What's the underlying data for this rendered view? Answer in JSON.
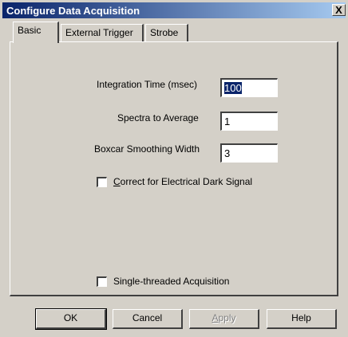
{
  "window": {
    "title": "Configure Data Acquisition",
    "close_label": "X"
  },
  "tabs": [
    {
      "label": "Basic",
      "active": true
    },
    {
      "label": "External Trigger",
      "active": false
    },
    {
      "label": "Strobe",
      "active": false
    }
  ],
  "fields": {
    "integration_time": {
      "label": "Integration Time (msec)",
      "value": "100"
    },
    "spectra_to_average": {
      "label": "Spectra to Average",
      "value": "1"
    },
    "boxcar_width": {
      "label": "Boxcar Smoothing Width",
      "value": "3"
    }
  },
  "checkboxes": {
    "dark_signal": {
      "label_first": "C",
      "label_rest": "orrect for Electrical Dark Signal",
      "checked": false
    },
    "single_thread": {
      "label": "Single-threaded Acquisition",
      "checked": false
    }
  },
  "buttons": {
    "ok": "OK",
    "cancel": "Cancel",
    "apply_first": "A",
    "apply_rest": "pply",
    "help": "Help"
  }
}
